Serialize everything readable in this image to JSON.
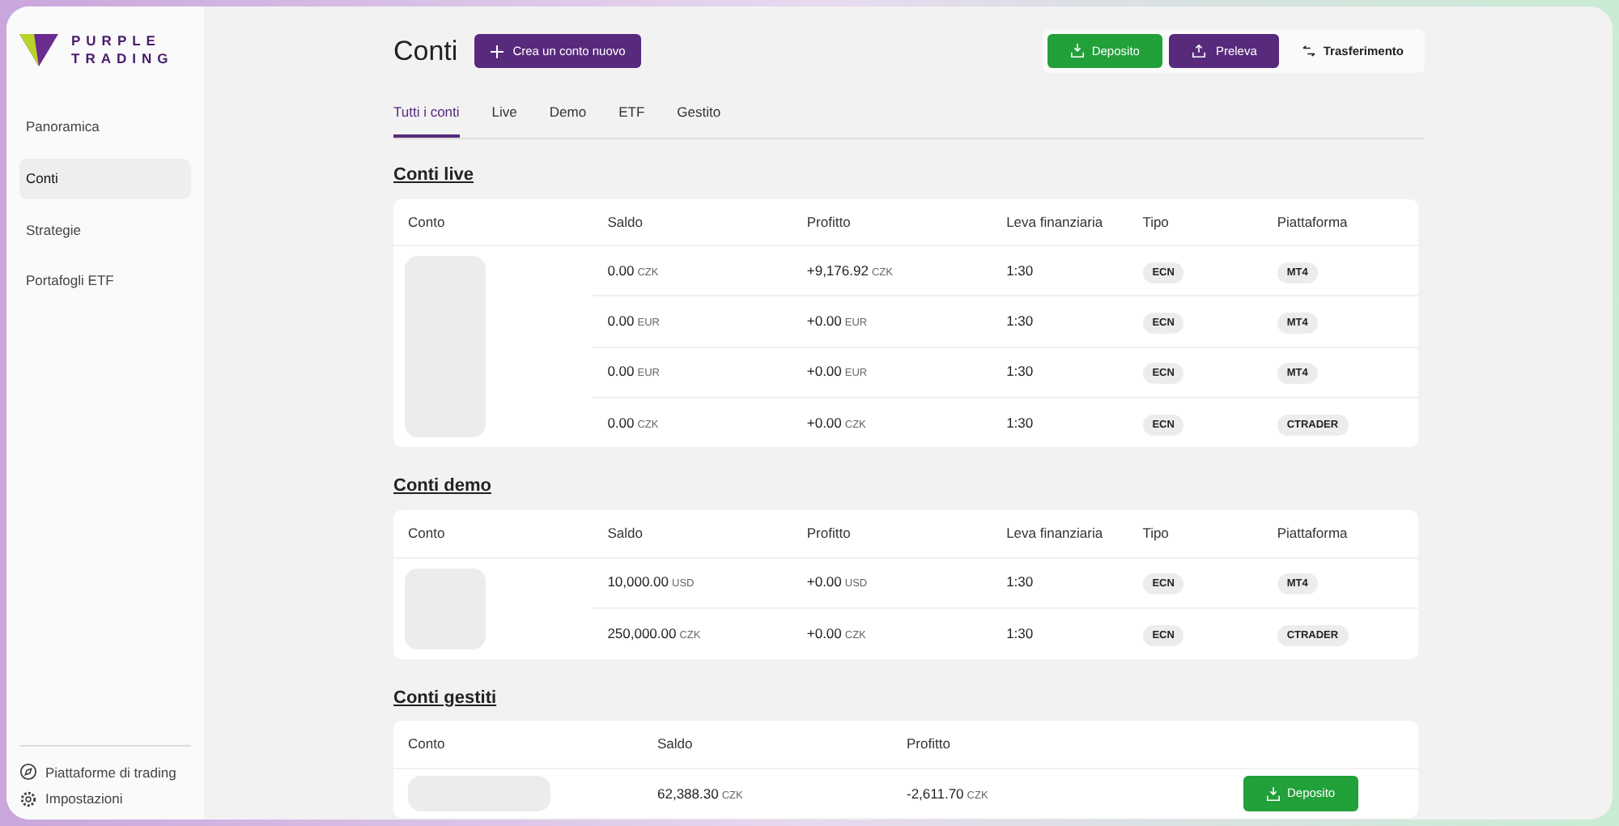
{
  "sidebar": {
    "logo": {
      "line1": "PURPLE",
      "line2": "TRADING"
    },
    "items": [
      {
        "label": "Panoramica",
        "selected": false
      },
      {
        "label": "Conti",
        "selected": true
      },
      {
        "label": "Strategie",
        "selected": false
      },
      {
        "label": "Portafogli ETF",
        "selected": false
      }
    ],
    "footer_items": [
      {
        "label": "Piattaforme di trading",
        "kind": "compass"
      },
      {
        "label": "Impostazioni",
        "kind": "gear"
      }
    ]
  },
  "header": {
    "title": "Conti",
    "create_button": "Crea un conto nuovo",
    "actions": [
      {
        "label": "Deposito",
        "kind": "deposit"
      },
      {
        "label": "Preleva",
        "kind": "withdraw"
      },
      {
        "label": "Trasferimento",
        "kind": "transfer"
      }
    ]
  },
  "tabs": [
    {
      "label": "Tutti i conti",
      "selected": true
    },
    {
      "label": "Live",
      "selected": false
    },
    {
      "label": "Demo",
      "selected": false
    },
    {
      "label": "ETF",
      "selected": false
    },
    {
      "label": "Gestito",
      "selected": false
    }
  ],
  "sections": [
    {
      "title": "Conti live",
      "kind": "trading",
      "columns": [
        "Conto",
        "Saldo",
        "Profitto",
        "Leva finanziaria",
        "Tipo",
        "Piattaforma"
      ],
      "rows": [
        {
          "saldo": {
            "amount": "0.00",
            "currency": "CZK"
          },
          "profitto": {
            "amount": "+9,176.92",
            "currency": "CZK"
          },
          "leva": "1:30",
          "tipo": "ECN",
          "piattaforma": "MT4"
        },
        {
          "saldo": {
            "amount": "0.00",
            "currency": "EUR"
          },
          "profitto": {
            "amount": "+0.00",
            "currency": "EUR"
          },
          "leva": "1:30",
          "tipo": "ECN",
          "piattaforma": "MT4"
        },
        {
          "saldo": {
            "amount": "0.00",
            "currency": "EUR"
          },
          "profitto": {
            "amount": "+0.00",
            "currency": "EUR"
          },
          "leva": "1:30",
          "tipo": "ECN",
          "piattaforma": "MT4"
        },
        {
          "saldo": {
            "amount": "0.00",
            "currency": "CZK"
          },
          "profitto": {
            "amount": "+0.00",
            "currency": "CZK"
          },
          "leva": "1:30",
          "tipo": "ECN",
          "piattaforma": "CTRADER"
        }
      ]
    },
    {
      "title": "Conti demo",
      "kind": "trading",
      "columns": [
        "Conto",
        "Saldo",
        "Profitto",
        "Leva finanziaria",
        "Tipo",
        "Piattaforma"
      ],
      "rows": [
        {
          "saldo": {
            "amount": "10,000.00",
            "currency": "USD"
          },
          "profitto": {
            "amount": "+0.00",
            "currency": "USD"
          },
          "leva": "1:30",
          "tipo": "ECN",
          "piattaforma": "MT4"
        },
        {
          "saldo": {
            "amount": "250,000.00",
            "currency": "CZK"
          },
          "profitto": {
            "amount": "+0.00",
            "currency": "CZK"
          },
          "leva": "1:30",
          "tipo": "ECN",
          "piattaforma": "CTRADER"
        }
      ]
    },
    {
      "title": "Conti gestiti",
      "kind": "managed",
      "columns": [
        "Conto",
        "Saldo",
        "Profitto"
      ],
      "rows": [
        {
          "saldo": {
            "amount": "62,388.30",
            "currency": "CZK"
          },
          "profitto": {
            "amount": "-2,611.70",
            "currency": "CZK"
          },
          "action": "Deposito"
        }
      ]
    }
  ]
}
